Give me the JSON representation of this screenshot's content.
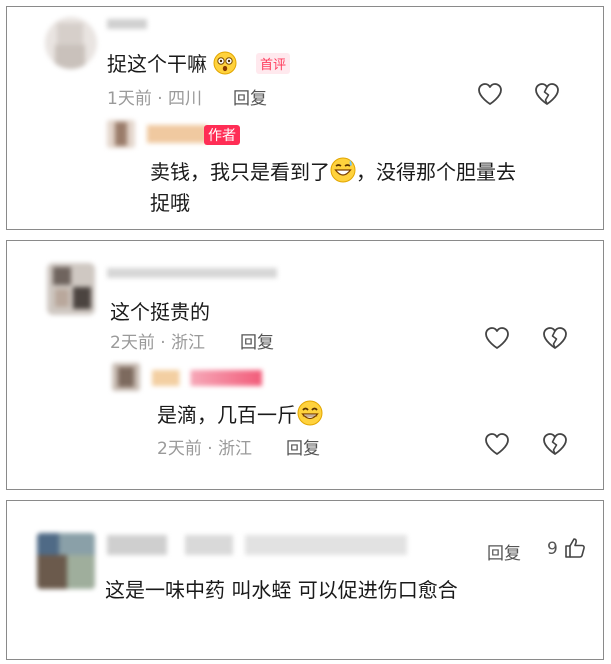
{
  "comments": [
    {
      "text": "捉这个干嘛",
      "badge": "首评",
      "meta": "1天前 · 四川",
      "reply_label": "回复",
      "emoji": "astonished-emoji",
      "sub_reply": {
        "badge": "作者",
        "text_line1_a": "卖钱，我只是看到了",
        "text_line1_b": "，没得那个胆量去",
        "text_line2": "捉哦",
        "emoji": "grin-sweat-emoji"
      }
    },
    {
      "text": "这个挺贵的",
      "meta": "2天前 · 浙江",
      "reply_label": "回复",
      "sub_reply": {
        "text": "是滴，几百一斤",
        "meta": "2天前 · 浙江",
        "reply_label": "回复",
        "emoji": "grin-emoji"
      }
    },
    {
      "text": "这是一味中药  叫水蛭  可以促进伤口愈合",
      "reply_label": "回复",
      "like_count": "9"
    }
  ],
  "icons": {
    "like": "heart-outline-icon",
    "dislike": "broken-heart-icon",
    "thumb": "thumbs-up-icon"
  },
  "colors": {
    "accent": "#ff2d55",
    "meta": "#9a9a9a"
  }
}
